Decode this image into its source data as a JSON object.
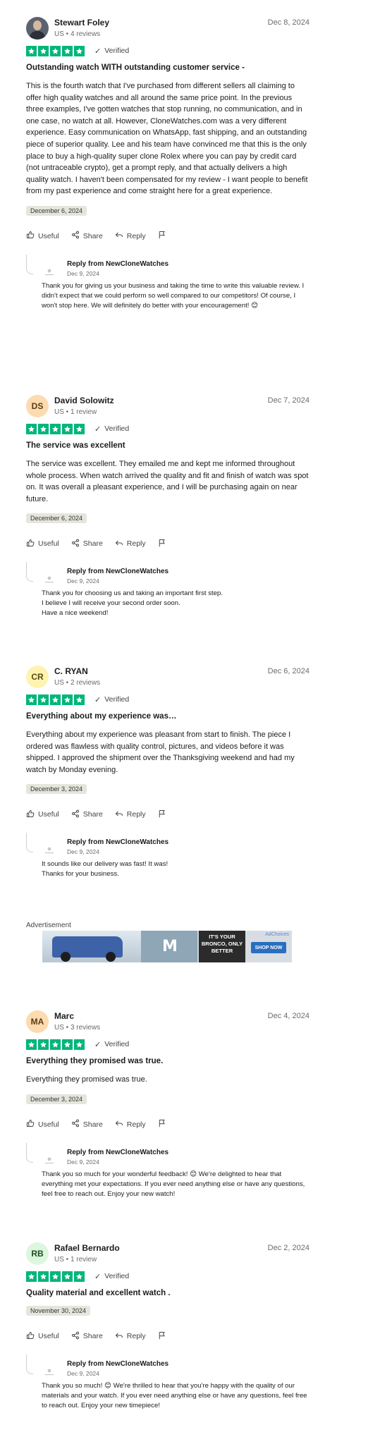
{
  "reviews": [
    {
      "name": "Stewart Foley",
      "meta": "US • 4 reviews",
      "date": "Dec 8, 2024",
      "avatar": {
        "type": "photo",
        "initials": "",
        "bg": "#5b6270",
        "fg": "#ffffff"
      },
      "rating": 5,
      "verified": "Verified",
      "title": "Outstanding watch WITH outstanding customer service -",
      "body": "This is the fourth watch that I've purchased from different sellers all claiming to offer high quality watches and all around the same price point. In the previous three examples, I've gotten watches that stop running, no communication, and in one case, no watch at all. However, CloneWatches.com was a very different experience. Easy communication on WhatsApp, fast shipping, and an outstanding piece of superior quality. Lee and his team have convinced me that this is the only place to buy a high-quality super clone Rolex where you can pay by credit card (not untraceable crypto), get a prompt reply, and that actually delivers a high quality watch. I haven't been compensated for my review - I want people to benefit from my past experience and come straight here for a great experience.",
      "experience_date": "December 6, 2024",
      "reply": {
        "from": "Reply from NewCloneWatches",
        "date": "Dec 9, 2024",
        "text": "Thank you for giving us your business and taking the time to write this valuable review. I didn't expect that we could perform so well compared to our competitors! Of course, I won't stop here. We will definitely do better with your encouragement! 😊"
      }
    },
    {
      "name": "David Solowitz",
      "meta": "US • 1 review",
      "date": "Dec 7, 2024",
      "avatar": {
        "type": "initials",
        "initials": "DS",
        "bg": "#fddbb0",
        "fg": "#5a3b12"
      },
      "rating": 5,
      "verified": "Verified",
      "title": "The service was excellent",
      "body": "The service was excellent. They emailed me and kept me informed throughout whole process. When watch arrived the quality and fit and finish of watch was spot on. It was overall a pleasant experience, and I will be purchasing again on near future.",
      "experience_date": "December 6, 2024",
      "reply": {
        "from": "Reply from NewCloneWatches",
        "date": "Dec 9, 2024",
        "text": "Thank you for choosing us and taking an important first step.\nI believe I will receive your second order soon.\nHave a nice weekend!"
      }
    },
    {
      "name": "C. RYAN",
      "meta": "US • 2 reviews",
      "date": "Dec 6, 2024",
      "avatar": {
        "type": "initials",
        "initials": "CR",
        "bg": "#fef3b0",
        "fg": "#5a4a0a"
      },
      "rating": 5,
      "verified": "Verified",
      "title": "Everything about my experience was…",
      "body": "Everything about my experience was pleasant from start to finish. The piece I ordered was flawless with quality control, pictures, and videos before it was shipped. I approved the shipment over the Thanksgiving weekend and had my watch by Monday evening.",
      "experience_date": "December 3, 2024",
      "reply": {
        "from": "Reply from NewCloneWatches",
        "date": "Dec 9, 2024",
        "text": "It sounds like our delivery was fast! It was!\nThanks for your business."
      }
    },
    {
      "name": "Marc",
      "meta": "US • 3 reviews",
      "date": "Dec 4, 2024",
      "avatar": {
        "type": "initials",
        "initials": "MA",
        "bg": "#fddbb0",
        "fg": "#5a3b12"
      },
      "rating": 5,
      "verified": "Verified",
      "title": "Everything they promised was true.",
      "body": "Everything they promised was true.",
      "experience_date": "December 3, 2024",
      "reply": {
        "from": "Reply from NewCloneWatches",
        "date": "Dec 9, 2024",
        "text": "Thank you so much for your wonderful feedback! 😊 We're delighted to hear that everything met your expectations. If you ever need anything else or have any questions, feel free to reach out. Enjoy your new watch!"
      }
    },
    {
      "name": "Rafael Bernardo",
      "meta": "US • 1 review",
      "date": "Dec 2, 2024",
      "avatar": {
        "type": "initials",
        "initials": "RB",
        "bg": "#dcf7dd",
        "fg": "#1f4d22"
      },
      "rating": 5,
      "verified": "Verified",
      "title": "Quality material and excellent watch .",
      "body": "",
      "experience_date": "November 30, 2024",
      "reply": {
        "from": "Reply from NewCloneWatches",
        "date": "Dec 9, 2024",
        "text": "Thank you so much! 😊 We're thrilled to hear that you're happy with the quality of our materials and your watch. If you ever need anything else or have any questions, feel free to reach out. Enjoy your new timepiece!"
      }
    }
  ],
  "actions": {
    "useful": "Useful",
    "share": "Share",
    "reply": "Reply"
  },
  "advertisement": {
    "label": "Advertisement",
    "tagline": "IT'S YOUR BRONCO, ONLY BETTER",
    "cta": "SHOP NOW",
    "adchoices": "AdChoices"
  },
  "colors": {
    "star_green": "#00b67a",
    "tag_bg": "#e5e5dd"
  }
}
